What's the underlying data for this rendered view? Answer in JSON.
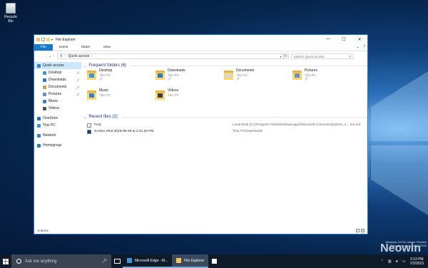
{
  "desktop": {
    "recycle_label": "Recycle Bin"
  },
  "window": {
    "title": "File Explorer",
    "controls": {
      "minimize": "—",
      "maximize": "☐",
      "close": "✕"
    },
    "ribbon": {
      "tabs": [
        "File",
        "Home",
        "Share",
        "View"
      ],
      "expand": "⌄",
      "help": "?"
    },
    "address": {
      "path": "Quick access",
      "search_placeholder": "Search Quick access"
    },
    "nav": [
      {
        "label": "Quick access",
        "icon": "star-icon",
        "color": "#3a7bd5",
        "pinned": false,
        "indent": 0
      },
      {
        "label": "Desktop",
        "icon": "desktop-folder-icon",
        "color": "#3a96dd",
        "pinned": true,
        "indent": 1
      },
      {
        "label": "Downloads",
        "icon": "downloads-icon",
        "color": "#2b78c9",
        "pinned": true,
        "indent": 1
      },
      {
        "label": "Documents",
        "icon": "documents-icon",
        "color": "#c9a35a",
        "pinned": true,
        "indent": 1
      },
      {
        "label": "Pictures",
        "icon": "pictures-icon",
        "color": "#6a8fc9",
        "pinned": true,
        "indent": 1
      },
      {
        "label": "Music",
        "icon": "music-icon",
        "color": "#3a7bd5",
        "pinned": false,
        "indent": 1
      },
      {
        "label": "Videos",
        "icon": "videos-icon",
        "color": "#555",
        "pinned": false,
        "indent": 1
      },
      {
        "label": "OneDrive",
        "icon": "onedrive-icon",
        "color": "#1f6cc4",
        "pinned": false,
        "indent": 0
      },
      {
        "label": "This PC",
        "icon": "this-pc-icon",
        "color": "#3a96dd",
        "pinned": false,
        "indent": 0
      },
      {
        "label": "Network",
        "icon": "network-icon",
        "color": "#3a7bd5",
        "pinned": false,
        "indent": 0
      },
      {
        "label": "Homegroup",
        "icon": "homegroup-icon",
        "color": "#2b78c9",
        "pinned": false,
        "indent": 0
      }
    ],
    "frequent_header": "Frequent folders (6)",
    "folders": [
      {
        "name": "Desktop",
        "location": "This PC",
        "pinned": true,
        "icon": "desktop-folder-icon"
      },
      {
        "name": "Downloads",
        "location": "This PC",
        "pinned": true,
        "icon": "downloads-folder-icon"
      },
      {
        "name": "Documents",
        "location": "This PC",
        "pinned": true,
        "icon": "documents-folder-icon"
      },
      {
        "name": "Pictures",
        "location": "This PC",
        "pinned": true,
        "icon": "pictures-folder-icon"
      },
      {
        "name": "Music",
        "location": "This PC",
        "pinned": false,
        "icon": "music-folder-icon"
      },
      {
        "name": "Videos",
        "location": "This PC",
        "pinned": false,
        "icon": "videos-folder-icon"
      }
    ],
    "recent_header": "Recent files (2)",
    "recent": [
      {
        "name": "FAQ",
        "location": "Local Disk (C:)\\Program Files\\WindowsApps\\Microsoft.ConnectivityStore_1....\\en-US",
        "icon": "faq-file-icon"
      },
      {
        "name": "Screen Shot 2015-06-28 at 2.01.20 PM",
        "location": "This PC\\Downloads",
        "icon": "image-file-icon"
      }
    ],
    "status": "8 items"
  },
  "taskbar": {
    "search_placeholder": "Ask me anything",
    "apps": [
      {
        "label": "Microsoft Edge - M...",
        "icon": "edge-icon",
        "active": false
      },
      {
        "label": "File Explorer",
        "icon": "file-explorer-icon",
        "active": true
      }
    ],
    "time": "3:13 PM",
    "date": "7/2/2015"
  },
  "watermark": {
    "line1": "Windows 10 Pro Insider Preview",
    "line2": "Evaluation copy. Build 10162"
  },
  "brand": "Neowin"
}
